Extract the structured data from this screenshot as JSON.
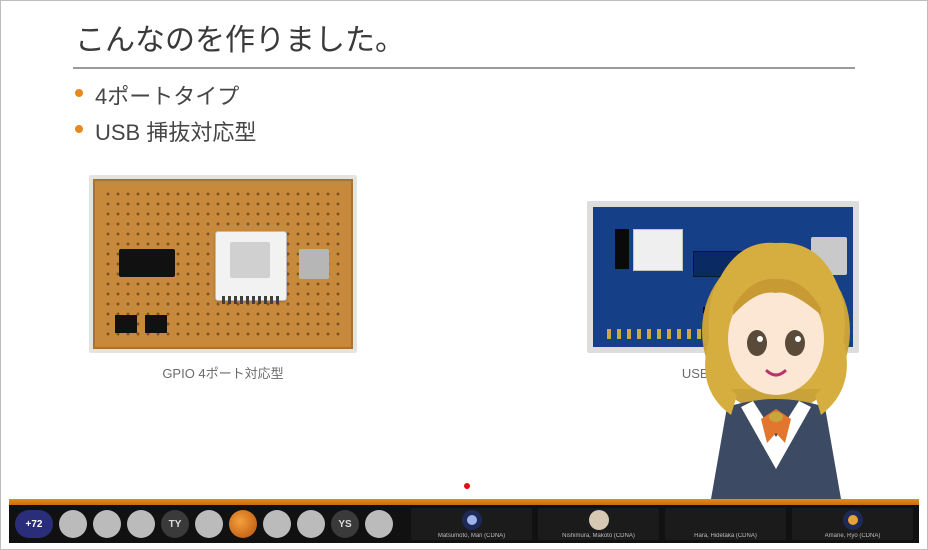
{
  "slide": {
    "title": "こんなのを作りました。",
    "bullets": [
      "4ポートタイプ",
      "USB 挿抜対応型"
    ],
    "figures": [
      {
        "id": "gpio-board",
        "caption": "GPIO 4ポート対応型"
      },
      {
        "id": "usb-board",
        "caption": "USB 挿抜対応"
      }
    ]
  },
  "participants": {
    "overflow_label": "+72",
    "avatars": [
      {
        "initials": "",
        "style": "light"
      },
      {
        "initials": "",
        "style": "light"
      },
      {
        "initials": "",
        "style": "light"
      },
      {
        "initials": "TY",
        "style": "dark"
      },
      {
        "initials": "",
        "style": "light"
      },
      {
        "initials": "",
        "style": "orange"
      },
      {
        "initials": "",
        "style": "light"
      },
      {
        "initials": "",
        "style": "light"
      },
      {
        "initials": "YS",
        "style": "dark"
      },
      {
        "initials": "",
        "style": "light"
      }
    ],
    "tiles": [
      {
        "name": "Matsumoto, Mari (CDNA)",
        "avatar": "navy"
      },
      {
        "name": "Nishimura, Makoto (CDNA)",
        "avatar": "light"
      },
      {
        "name": "Hara, Hidetaka (CDNA)",
        "avatar": "brown"
      },
      {
        "name": "Amane, Ryo (CDNA)",
        "avatar": "navy"
      }
    ]
  }
}
